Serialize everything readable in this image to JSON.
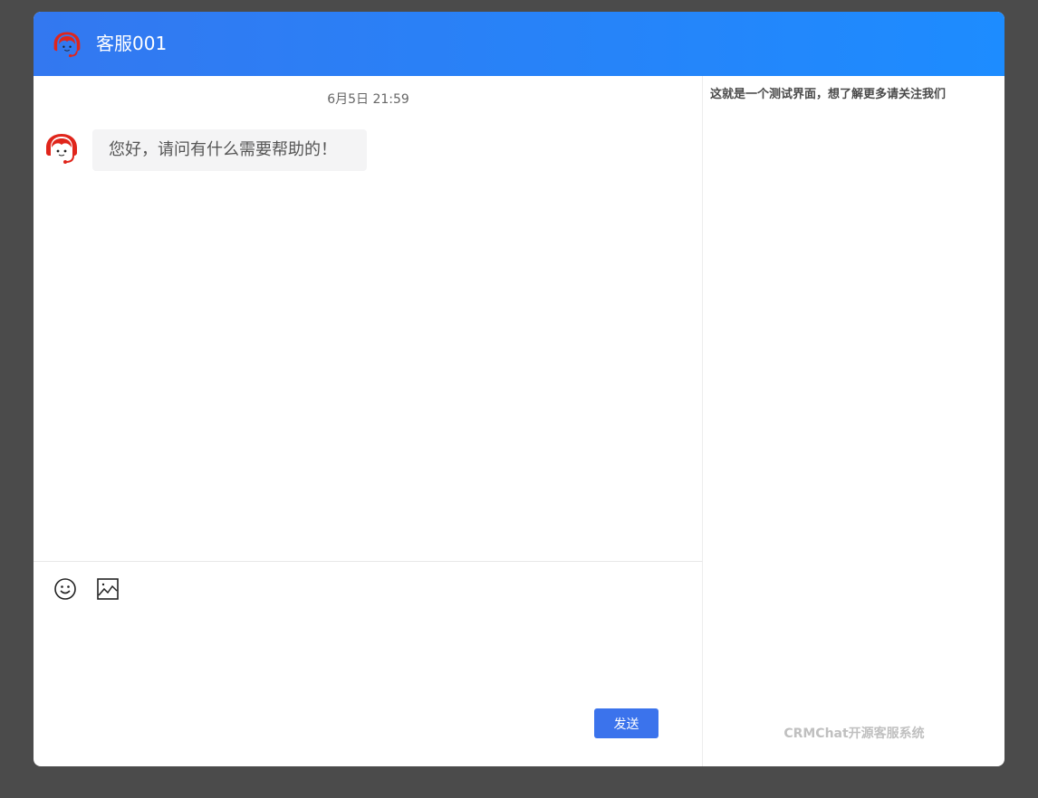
{
  "header": {
    "title": "客服001",
    "avatar_icon": "agent-avatar-icon"
  },
  "chat": {
    "timestamp": "6月5日 21:59",
    "messages": [
      {
        "sender": "agent",
        "avatar_icon": "agent-avatar-icon",
        "text": "您好，请问有什么需要帮助的！"
      }
    ]
  },
  "composer": {
    "tools": [
      {
        "name": "emoji",
        "icon": "smiley-icon"
      },
      {
        "name": "image",
        "icon": "image-icon"
      }
    ],
    "input_value": "",
    "send_label": "发送"
  },
  "sidebar": {
    "notice": "这就是一个测试界面，想了解更多请关注我们",
    "brand": "CRMChat开源客服系统"
  },
  "colors": {
    "header_gradient_start": "#3378f0",
    "header_gradient_end": "#1d8cff",
    "send_button": "#3b73ec",
    "avatar_red": "#e0251b",
    "page_background": "#4b4b4b"
  }
}
